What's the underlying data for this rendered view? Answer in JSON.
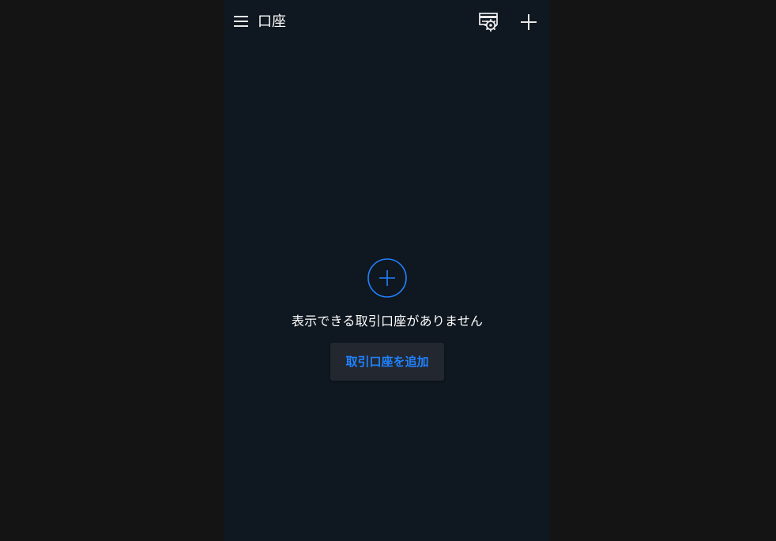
{
  "header": {
    "title": "口座",
    "menu_icon": "hamburger-menu-icon",
    "settings_icon": "account-settings-icon",
    "add_icon": "plus-icon"
  },
  "empty_state": {
    "icon": "circle-plus-icon",
    "message": "表示できる取引口座がありません",
    "add_button_label": "取引口座を追加"
  },
  "colors": {
    "page_background": "#141414",
    "app_background": "#0f1720",
    "accent": "#1f82ff",
    "button_background": "#23272f",
    "text": "#ffffff"
  }
}
